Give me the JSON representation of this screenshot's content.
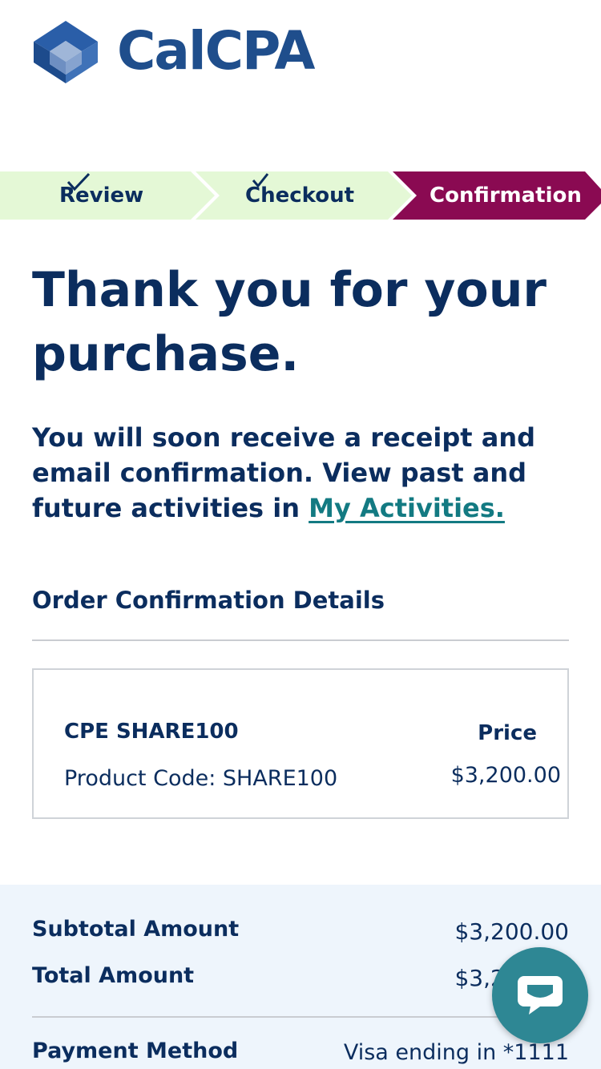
{
  "brand": {
    "name": "CalCPA",
    "logo_icon": "calcpa-cube-logo",
    "color": "#1f4e8c"
  },
  "stepper": {
    "steps": [
      {
        "label": "Review",
        "state": "complete",
        "icon": "check-icon"
      },
      {
        "label": "Checkout",
        "state": "complete",
        "icon": "check-icon"
      },
      {
        "label": "Confirmation",
        "state": "active"
      }
    ],
    "complete_color": "#e4f8d6",
    "active_color": "#8a0a52"
  },
  "page": {
    "title": "Thank you for your purchase.",
    "intro_text": "You will soon receive a receipt and email confirmation. View past and future activities in ",
    "link_text": "My Activities."
  },
  "order": {
    "section_title": "Order Confirmation Details",
    "product_name": "CPE SHARE100",
    "product_code": "Product Code: SHARE100",
    "price_label": "Price",
    "price_value": "$3,200.00"
  },
  "summary": {
    "subtotal_label": "Subtotal Amount",
    "subtotal_value": "$3,200.00",
    "total_label": "Total Amount",
    "total_value": "$3,200.00",
    "payment_label": "Payment Method",
    "payment_value": "Visa ending in *1111"
  },
  "chat": {
    "icon": "chat-bubble-icon",
    "color": "#2e8794"
  }
}
